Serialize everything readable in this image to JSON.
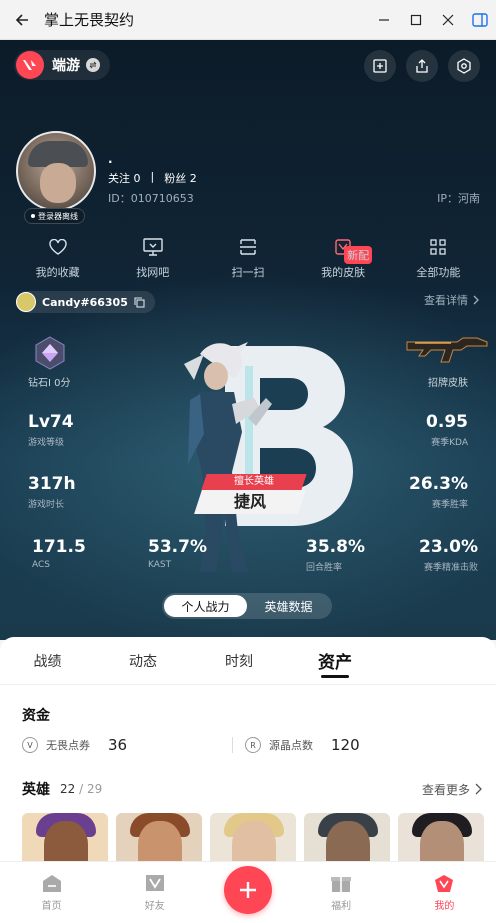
{
  "window": {
    "title": "掌上无畏契约"
  },
  "brand": {
    "name": "端游"
  },
  "profile": {
    "username": ".",
    "status_badge": "登录器离线",
    "follow_label": "关注",
    "follow_count": "0",
    "fans_label": "粉丝",
    "fans_count": "2",
    "separator": "|",
    "id_text": "ID：010710653",
    "ip_text": "IP：河南"
  },
  "quick_actions": [
    {
      "label": "我的收藏",
      "icon": "heart-icon"
    },
    {
      "label": "找网吧",
      "icon": "monitor-icon"
    },
    {
      "label": "扫一扫",
      "icon": "scan-icon"
    },
    {
      "label": "我的皮肤",
      "icon": "skin-icon",
      "badge": "新配"
    },
    {
      "label": "全部功能",
      "icon": "grid-icon"
    }
  ],
  "riot_tag": {
    "name": "Candy#66305"
  },
  "detail_link": "查看详情",
  "rank": {
    "label": "钻石I 0分"
  },
  "skin": {
    "label": "招牌皮肤"
  },
  "best_agent": {
    "title": "擅长英雄",
    "name": "捷风"
  },
  "stats": {
    "level": {
      "value": "Lv74",
      "label": "游戏等级"
    },
    "kda": {
      "value": "0.95",
      "label": "赛季KDA"
    },
    "time": {
      "value": "317h",
      "label": "游戏时长"
    },
    "winrate": {
      "value": "26.3%",
      "label": "赛季胜率"
    },
    "acs": {
      "value": "171.5",
      "label": "ACS"
    },
    "kast": {
      "value": "53.7%",
      "label": "KAST"
    },
    "round_win": {
      "value": "35.8%",
      "label": "回合胜率"
    },
    "first_kill": {
      "value": "23.0%",
      "label": "赛季精准击败"
    }
  },
  "toggle": {
    "left": "个人战力",
    "right": "英雄数据"
  },
  "tabs": [
    "战绩",
    "动态",
    "时刻",
    "资产"
  ],
  "assets": {
    "funds_title": "资金",
    "coins": [
      {
        "name": "无畏点券",
        "value": "36",
        "icon": "v-points-icon"
      },
      {
        "name": "源晶点数",
        "value": "120",
        "icon": "radianite-icon"
      }
    ],
    "agents_title": "英雄",
    "agents_owned": "22",
    "agents_total": "/ 29",
    "more_label": "查看更多"
  },
  "nav": [
    {
      "label": "首页",
      "icon": "home-icon"
    },
    {
      "label": "好友",
      "icon": "friends-icon"
    },
    {
      "label": "福利",
      "icon": "gift-icon"
    },
    {
      "label": "我的",
      "icon": "profile-icon"
    }
  ],
  "colors": {
    "accent": "#ff4655",
    "hero_bg": "#102536",
    "sheet_bg": "#ffffff"
  }
}
